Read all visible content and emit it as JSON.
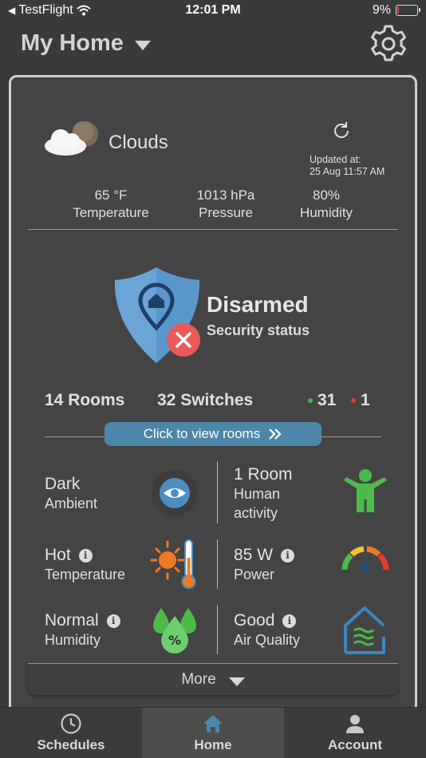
{
  "status_bar": {
    "back_app": "TestFlight",
    "time": "12:01 PM",
    "battery_pct": "9%",
    "battery_level": 0.09
  },
  "header": {
    "title": "My Home"
  },
  "weather": {
    "condition": "Clouds",
    "updated_label": "Updated at:",
    "updated_time": "25 Aug 11:57 AM",
    "stats": [
      {
        "value": "65 °F",
        "label": "Temperature"
      },
      {
        "value": "1013 hPa",
        "label": "Pressure"
      },
      {
        "value": "80%",
        "label": "Humidity"
      }
    ]
  },
  "security": {
    "status": "Disarmed",
    "label": "Security status"
  },
  "summary": {
    "rooms": "14 Rooms",
    "switches": "32 Switches",
    "online": "31",
    "offline": "1"
  },
  "rooms_button": {
    "label": "Click to view rooms"
  },
  "tiles": {
    "ambient": {
      "title": "Dark",
      "sub": "Ambient"
    },
    "human": {
      "title": "1 Room",
      "sub1": "Human",
      "sub2": "activity"
    },
    "temperature": {
      "title": "Hot",
      "sub": "Temperature"
    },
    "power": {
      "title": "85 W",
      "sub": "Power"
    },
    "humidity": {
      "title": "Normal",
      "sub": "Humidity"
    },
    "air": {
      "title": "Good",
      "sub": "Air Quality"
    }
  },
  "more": {
    "label": "More"
  },
  "tabs": [
    {
      "label": "Schedules",
      "icon": "clock-icon"
    },
    {
      "label": "Home",
      "icon": "home-icon"
    },
    {
      "label": "Account",
      "icon": "person-icon"
    }
  ],
  "colors": {
    "accent": "#4c86a8",
    "online": "#4caf50",
    "offline": "#e53935",
    "card_bg": "#444444"
  }
}
